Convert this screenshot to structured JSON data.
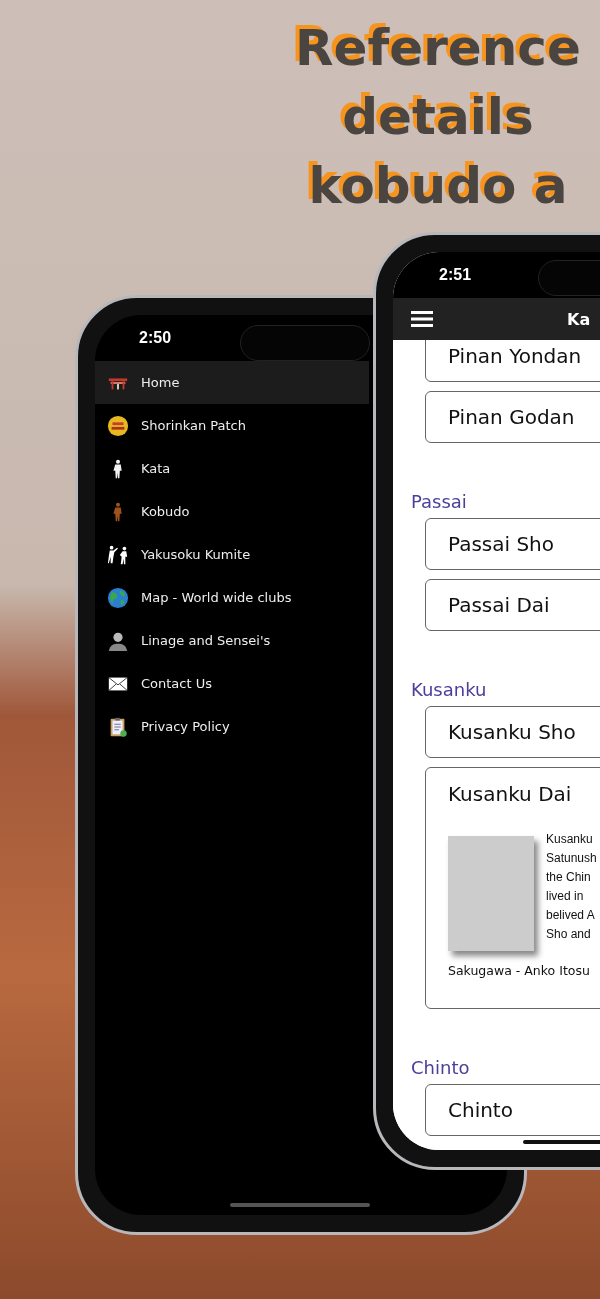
{
  "headline": [
    "Reference",
    "details",
    "kobudo a"
  ],
  "menu_phone": {
    "time": "2:50",
    "items": [
      {
        "label": "Home",
        "selected": true,
        "kind": "gate"
      },
      {
        "label": "Shorinkan Patch",
        "selected": false,
        "kind": "patch"
      },
      {
        "label": "Kata",
        "selected": false,
        "kind": "karateka"
      },
      {
        "label": "Kobudo",
        "selected": false,
        "kind": "kobudoka"
      },
      {
        "label": "Yakusoku Kumite",
        "selected": false,
        "kind": "sparring"
      },
      {
        "label": "Map - World wide clubs",
        "selected": false,
        "kind": "globe"
      },
      {
        "label": "Linage and Sensei's",
        "selected": false,
        "kind": "person"
      },
      {
        "label": "Contact Us",
        "selected": false,
        "kind": "envelope"
      },
      {
        "label": "Privacy Policy",
        "selected": false,
        "kind": "clipboard"
      }
    ]
  },
  "kata_phone": {
    "time": "2:51",
    "title": "Ka",
    "sections": [
      {
        "items": [
          {
            "label": "Pinan Yondan",
            "expanded": false
          },
          {
            "label": "Pinan Godan",
            "expanded": false
          }
        ]
      },
      {
        "heading": "Passai",
        "items": [
          {
            "label": "Passai Sho",
            "expanded": false
          },
          {
            "label": "Passai Dai",
            "expanded": false
          }
        ]
      },
      {
        "heading": "Kusanku",
        "items": [
          {
            "label": "Kusanku Sho",
            "expanded": false
          },
          {
            "label": "Kusanku Dai",
            "expanded": true,
            "description_lines": [
              "Kusanku",
              "Satunush",
              "the Chin",
              "lived in",
              "belived A",
              "Sho and"
            ],
            "caption": "Sakugawa - Anko Itosu"
          }
        ]
      },
      {
        "heading": "Chinto",
        "items": [
          {
            "label": "Chinto",
            "expanded": false
          }
        ]
      }
    ]
  }
}
